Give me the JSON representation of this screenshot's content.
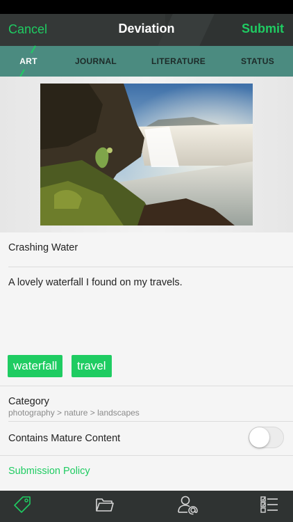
{
  "navbar": {
    "cancel_label": "Cancel",
    "title": "Deviation",
    "submit_label": "Submit"
  },
  "tabs": [
    {
      "label": "ART",
      "active": true
    },
    {
      "label": "JOURNAL",
      "active": false
    },
    {
      "label": "LITERATURE",
      "active": false
    },
    {
      "label": "STATUS",
      "active": false
    }
  ],
  "form": {
    "title_value": "Crashing Water",
    "description_value": "A lovely waterfall I found on my travels.",
    "tags": [
      "waterfall",
      "travel"
    ],
    "category_label": "Category",
    "category_path": "photography > nature > landscapes",
    "mature_label": "Contains Mature Content",
    "mature_enabled": false,
    "policy_label": "Submission Policy"
  },
  "bottom_bar": {
    "icons": [
      "tag-icon",
      "folder-icon",
      "mention-user-icon",
      "checklist-icon"
    ]
  },
  "colors": {
    "accent": "#1fcc62",
    "navbar": "#2f3332",
    "tabbar": "#4b8b80"
  }
}
